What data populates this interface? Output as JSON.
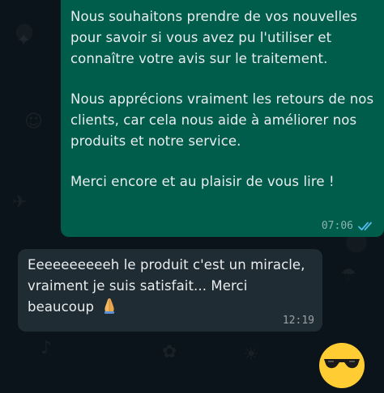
{
  "conversation": {
    "outgoing": {
      "paragraphs": [
        "Nous souhaitons prendre de vos nouvelles pour savoir si vous avez pu l'utiliser et connaître votre avis sur le traitement.",
        "Nous apprécions vraiment les retours de nos clients, car cela nous aide à améliorer nos produits et notre service.",
        "Merci encore et au plaisir de vous lire !"
      ],
      "time": "07:06",
      "status_icon": "double-check-read-icon"
    },
    "incoming": {
      "text": "Eeeeeeeeeeh le produit c'est un miracle, vraiment je suis satisfait... Merci beaucoup",
      "emoji_icon": "folded-hands-emoji-icon",
      "time": "12:19"
    },
    "peek_emoji_icon": "sunglasses-face-emoji-icon"
  },
  "colors": {
    "background": "#0b141a",
    "outgoing_bubble": "#005c4b",
    "incoming_bubble": "#202c33",
    "text": "#e9edef",
    "read_ticks": "#53bdeb"
  }
}
